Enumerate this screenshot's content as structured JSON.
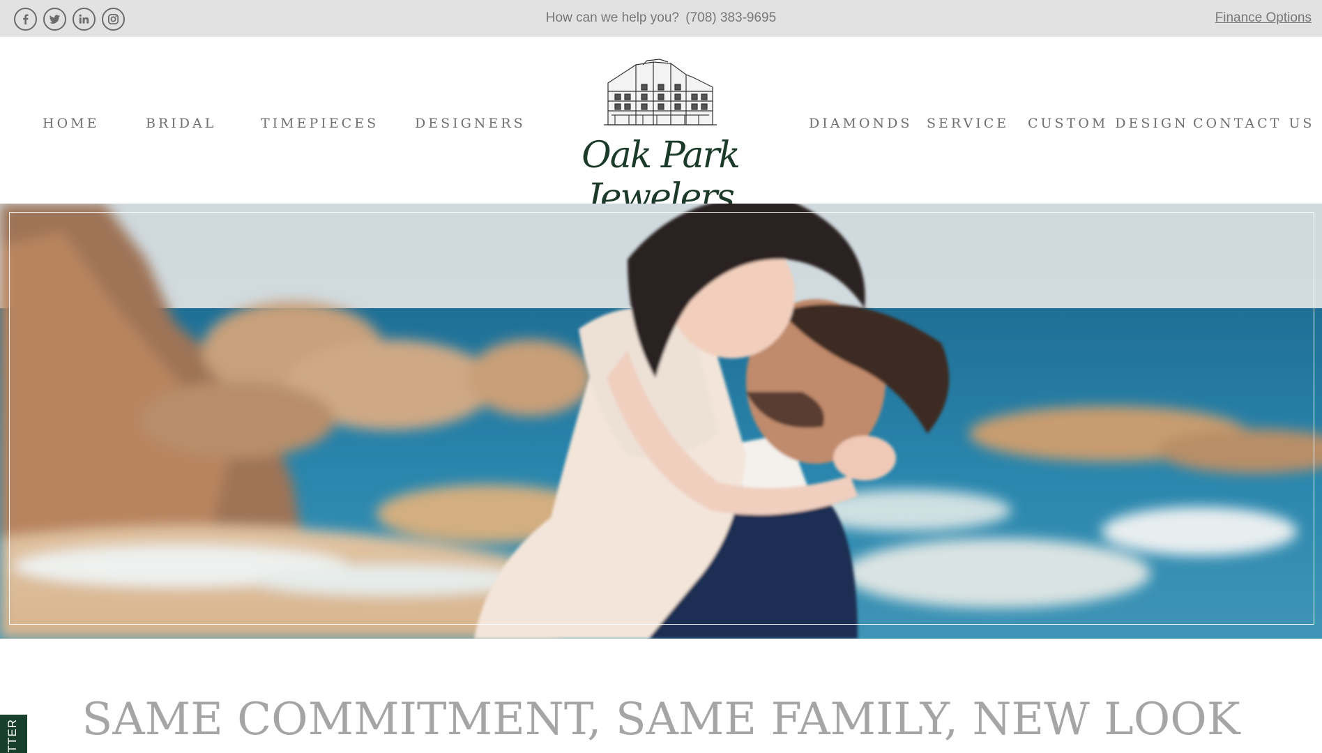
{
  "topbar": {
    "social": [
      {
        "name": "facebook-icon",
        "glyph": "f"
      },
      {
        "name": "twitter-icon",
        "glyph": "twitter"
      },
      {
        "name": "linkedin-icon",
        "glyph": "in"
      },
      {
        "name": "instagram-icon",
        "glyph": "camera"
      }
    ],
    "help_text": "How can we help you?",
    "phone": "(708) 383-9695",
    "finance_label": "Finance Options"
  },
  "nav": {
    "left": [
      "HOME",
      "BRIDAL",
      "TIMEPIECES",
      "DESIGNERS"
    ],
    "right": [
      "DIAMONDS",
      "SERVICE",
      "CUSTOM DESIGN",
      "CONTACT US"
    ]
  },
  "logo": {
    "text": "Oak Park Jewelers",
    "color": "#1b3a2a"
  },
  "hero": {
    "image": "couple-embracing-on-beach"
  },
  "headline": "SAME COMMITMENT, SAME FAMILY, NEW LOOK",
  "side_tab": {
    "label": "TTER",
    "color": "#173f29"
  }
}
